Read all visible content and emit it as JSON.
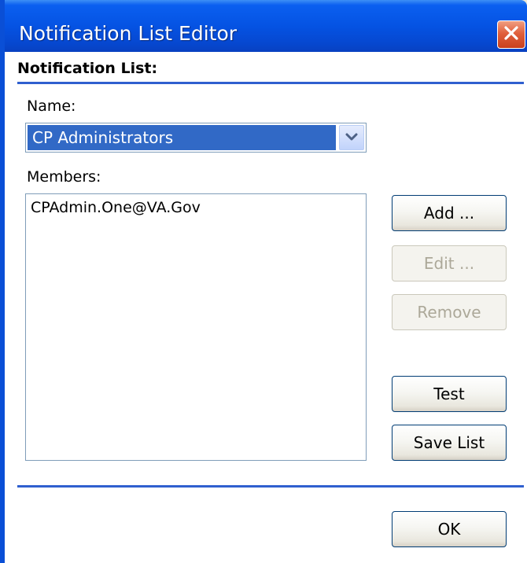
{
  "window": {
    "title": "Notification List Editor"
  },
  "notification_list": {
    "heading": "Notification List:",
    "name_label": "Name:",
    "name_selected": "CP Administrators",
    "members_label": "Members:",
    "members": [
      "CPAdmin.One@VA.Gov"
    ]
  },
  "buttons": {
    "add": "Add ...",
    "edit": "Edit ...",
    "remove": "Remove",
    "test": "Test",
    "save_list": "Save List",
    "ok": "OK"
  },
  "colors": {
    "titlebar": "#0553e3",
    "selection": "#3169c6",
    "close_button": "#e0603c",
    "separator": "#2f5fcf"
  },
  "icons": {
    "close": "close-icon",
    "dropdown": "chevron-down-icon"
  }
}
